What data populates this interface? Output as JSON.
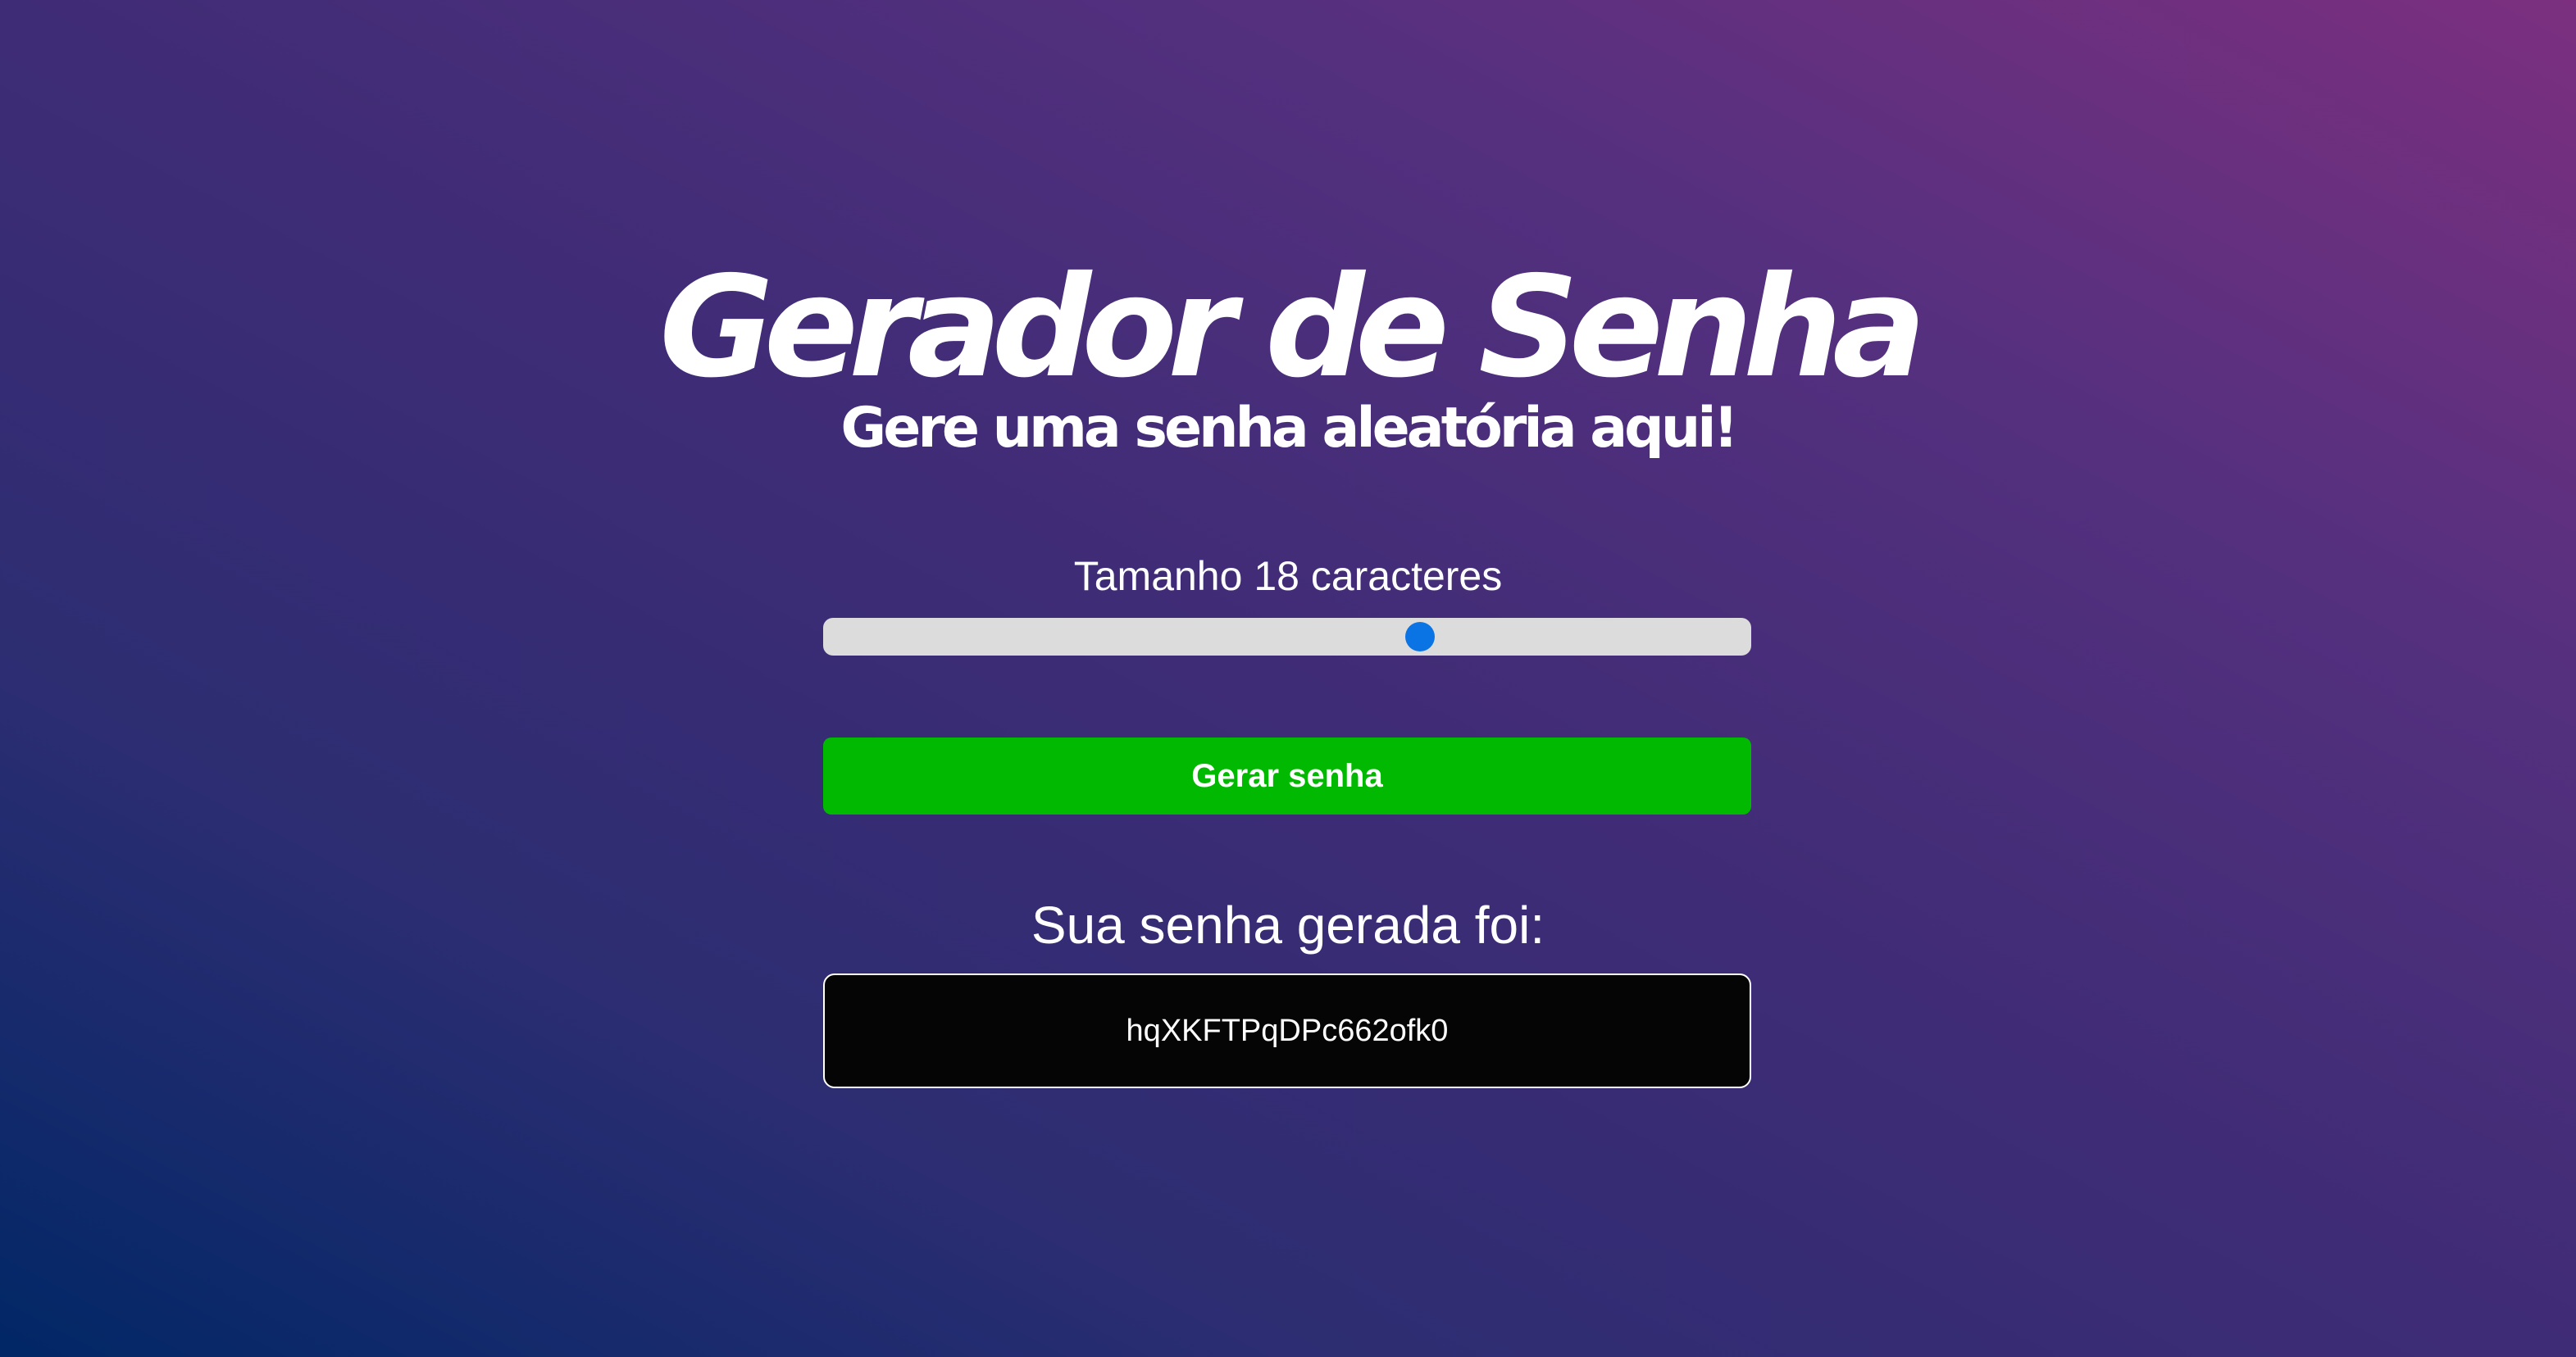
{
  "header": {
    "title": "Gerador de Senha",
    "subtitle": "Gere uma senha aleatória aqui!"
  },
  "length": {
    "label": "Tamanho 18 caracteres",
    "value": 18,
    "slider_fraction": 0.643
  },
  "generate_button": {
    "label": "Gerar senha"
  },
  "result": {
    "heading": "Sua senha gerada foi:",
    "password": "hqXKFTPqDPc662ofk0"
  },
  "colors": {
    "button": "#00b900",
    "slider_thumb": "#0b74e5",
    "slider_track": "#dcdcdc",
    "password_box": "#050505"
  }
}
